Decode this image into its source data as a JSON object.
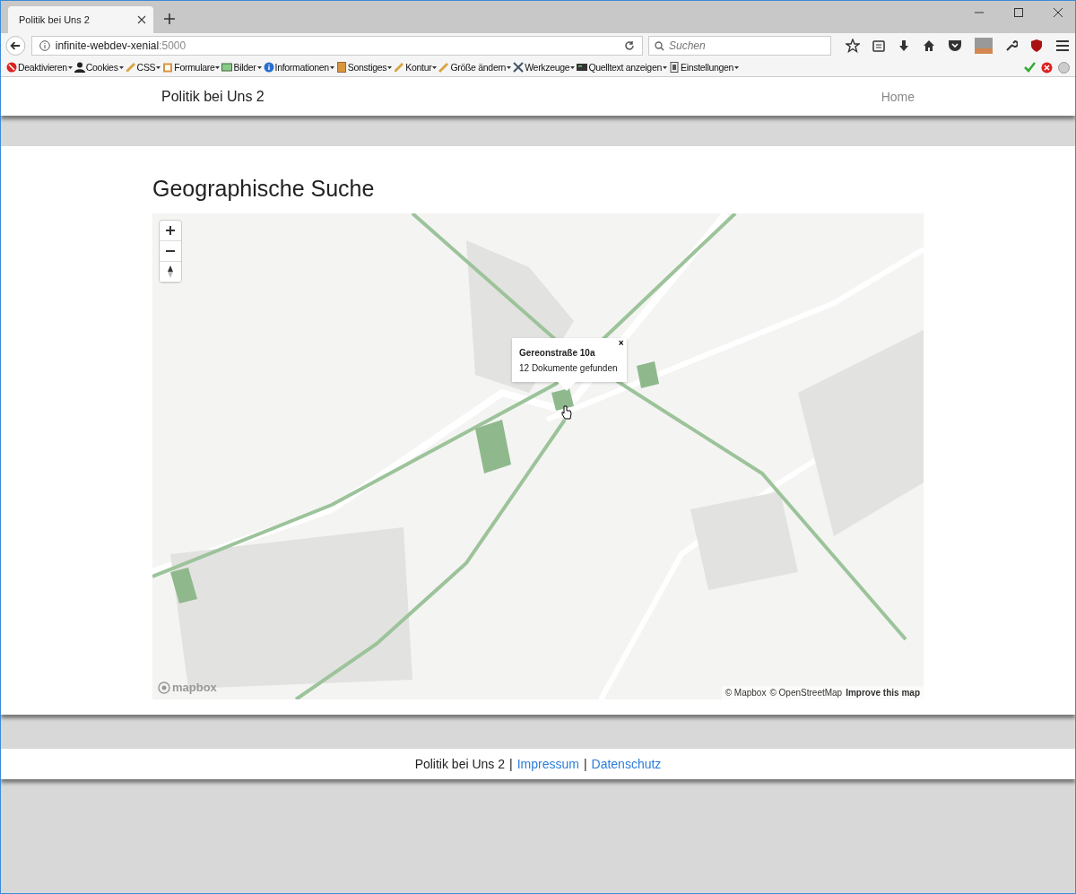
{
  "browser": {
    "tab_title": "Politik bei Uns 2",
    "url_host": "infinite-webdev-xenial",
    "url_port": ":5000",
    "search_placeholder": "Suchen",
    "toolbar": [
      {
        "label": "Deaktivieren"
      },
      {
        "label": "Cookies"
      },
      {
        "label": "CSS"
      },
      {
        "label": "Formulare"
      },
      {
        "label": "Bilder"
      },
      {
        "label": "Informationen"
      },
      {
        "label": "Sonstiges"
      },
      {
        "label": "Kontur"
      },
      {
        "label": "Größe ändern"
      },
      {
        "label": "Werkzeuge"
      },
      {
        "label": "Quelltext anzeigen"
      },
      {
        "label": "Einstellungen"
      }
    ]
  },
  "navbar": {
    "brand": "Politik bei Uns 2",
    "links": [
      {
        "label": "Home",
        "selected": false
      }
    ]
  },
  "heading": "Geographische Suche",
  "map": {
    "popup": {
      "close": "×",
      "title": "Gereonstraße 10a",
      "text": "12 Dokumente gefunden"
    },
    "logo": "mapbox",
    "attribution": [
      "© Mapbox",
      "© OpenStreetMap"
    ],
    "improve": "Improve this map"
  },
  "footer": {
    "brand": "Politik bei Uns 2",
    "separator": "|",
    "links": [
      "Impressum",
      "Datenschutz"
    ]
  }
}
